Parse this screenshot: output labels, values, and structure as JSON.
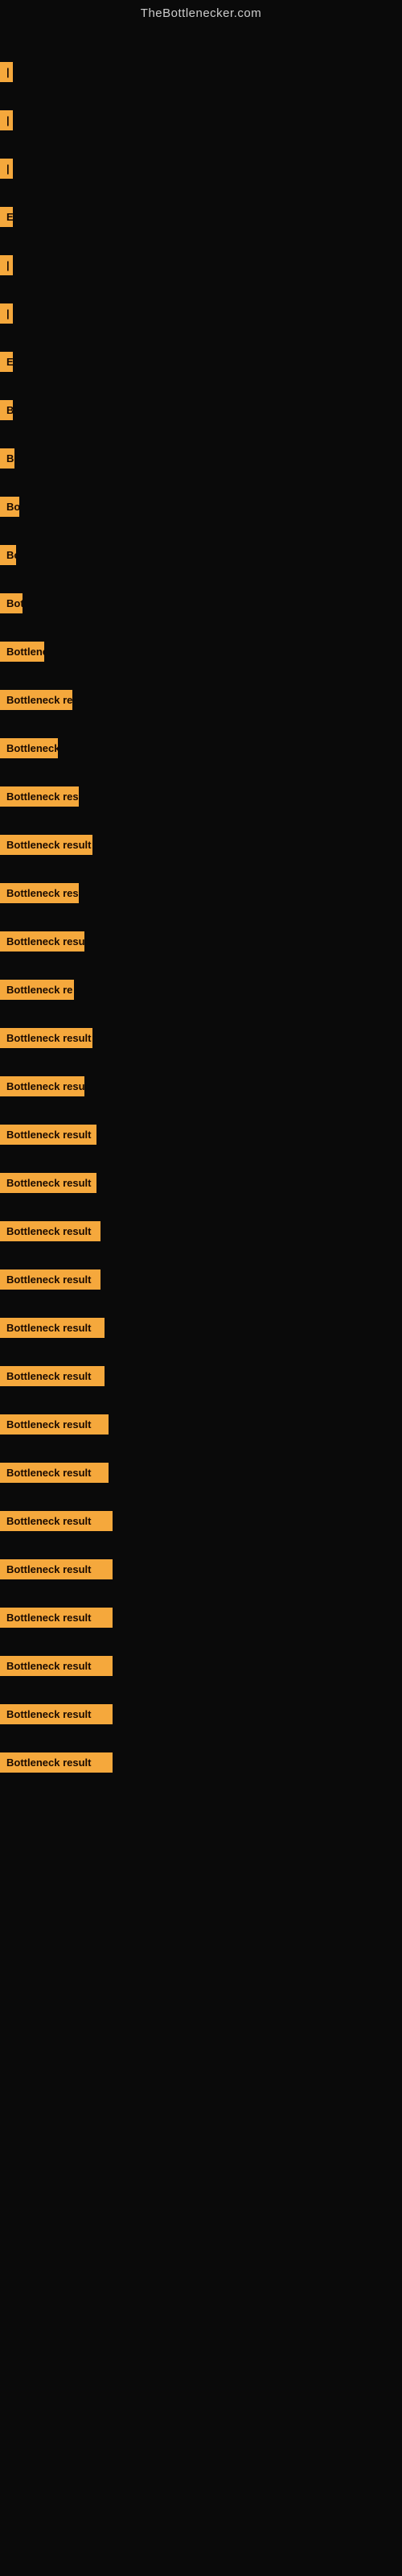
{
  "site": {
    "title": "TheBottlenecker.com"
  },
  "items": [
    {
      "id": 1,
      "label": "|",
      "width": 6
    },
    {
      "id": 2,
      "label": "|",
      "width": 6
    },
    {
      "id": 3,
      "label": "|",
      "width": 6
    },
    {
      "id": 4,
      "label": "E",
      "width": 10
    },
    {
      "id": 5,
      "label": "|",
      "width": 6
    },
    {
      "id": 6,
      "label": "|",
      "width": 6
    },
    {
      "id": 7,
      "label": "E",
      "width": 10
    },
    {
      "id": 8,
      "label": "B",
      "width": 12
    },
    {
      "id": 9,
      "label": "Bo",
      "width": 18
    },
    {
      "id": 10,
      "label": "Bot",
      "width": 24
    },
    {
      "id": 11,
      "label": "Bo",
      "width": 20
    },
    {
      "id": 12,
      "label": "Bott",
      "width": 28
    },
    {
      "id": 13,
      "label": "Bottlene",
      "width": 55
    },
    {
      "id": 14,
      "label": "Bottleneck re",
      "width": 90
    },
    {
      "id": 15,
      "label": "Bottleneck",
      "width": 72
    },
    {
      "id": 16,
      "label": "Bottleneck res",
      "width": 98
    },
    {
      "id": 17,
      "label": "Bottleneck result",
      "width": 115
    },
    {
      "id": 18,
      "label": "Bottleneck res",
      "width": 98
    },
    {
      "id": 19,
      "label": "Bottleneck resu",
      "width": 105
    },
    {
      "id": 20,
      "label": "Bottleneck re",
      "width": 92
    },
    {
      "id": 21,
      "label": "Bottleneck result",
      "width": 115
    },
    {
      "id": 22,
      "label": "Bottleneck resu",
      "width": 105
    },
    {
      "id": 23,
      "label": "Bottleneck result",
      "width": 120
    },
    {
      "id": 24,
      "label": "Bottleneck result",
      "width": 120
    },
    {
      "id": 25,
      "label": "Bottleneck result",
      "width": 125
    },
    {
      "id": 26,
      "label": "Bottleneck result",
      "width": 125
    },
    {
      "id": 27,
      "label": "Bottleneck result",
      "width": 130
    },
    {
      "id": 28,
      "label": "Bottleneck result",
      "width": 130
    },
    {
      "id": 29,
      "label": "Bottleneck result",
      "width": 135
    },
    {
      "id": 30,
      "label": "Bottleneck result",
      "width": 135
    },
    {
      "id": 31,
      "label": "Bottleneck result",
      "width": 140
    },
    {
      "id": 32,
      "label": "Bottleneck result",
      "width": 140
    },
    {
      "id": 33,
      "label": "Bottleneck result",
      "width": 140
    },
    {
      "id": 34,
      "label": "Bottleneck result",
      "width": 140
    },
    {
      "id": 35,
      "label": "Bottleneck result",
      "width": 140
    },
    {
      "id": 36,
      "label": "Bottleneck result",
      "width": 140
    }
  ]
}
